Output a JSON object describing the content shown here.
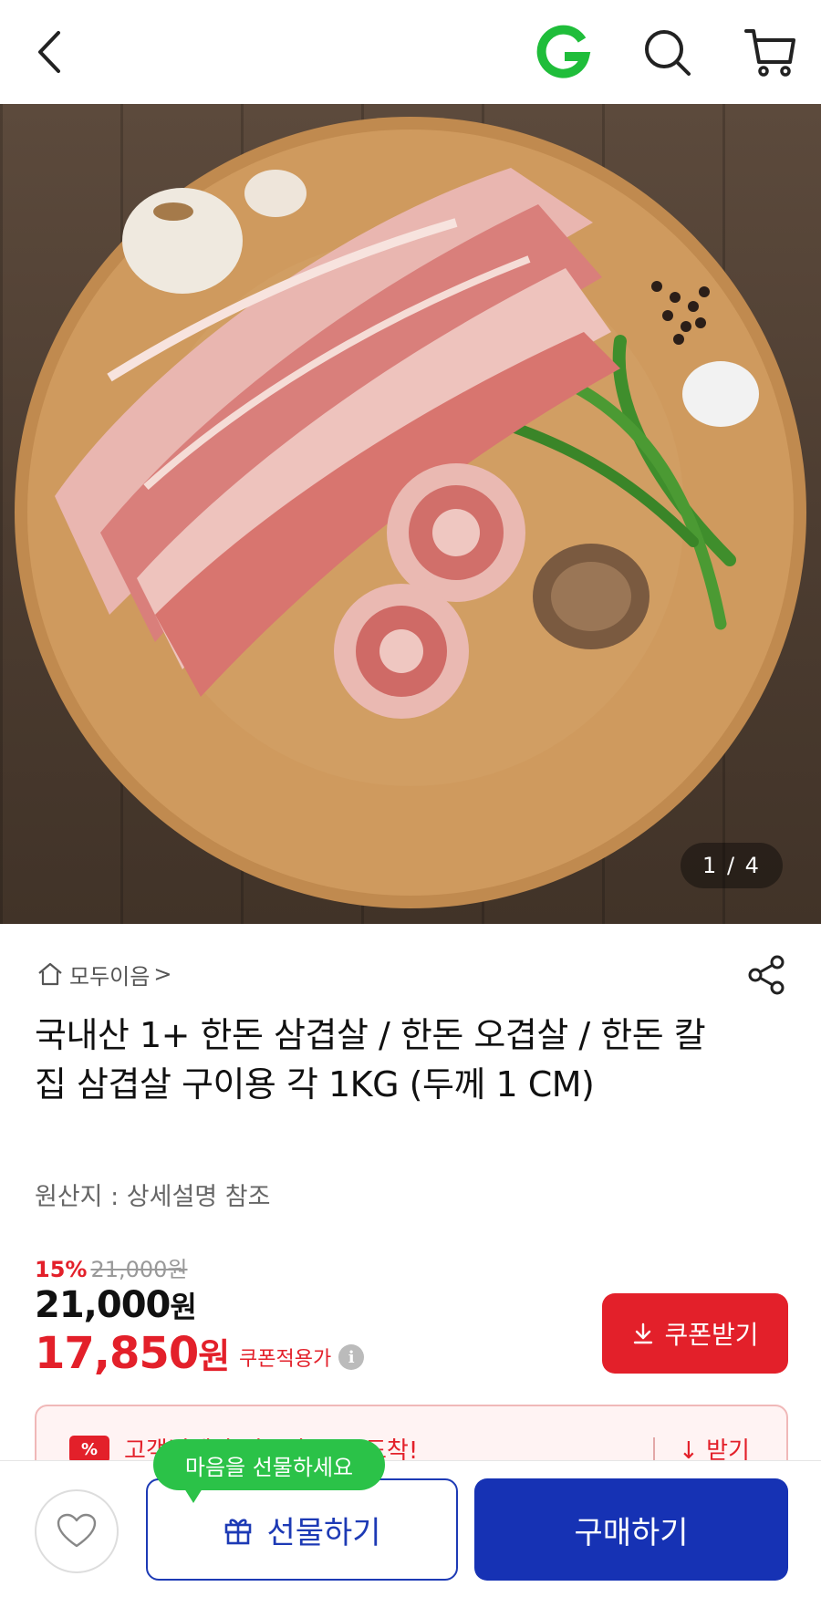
{
  "header": {
    "back_icon": "chevron-left-icon",
    "logo_icon": "g-logo-icon",
    "search_icon": "search-icon",
    "cart_icon": "cart-icon",
    "logo_color": "#1fbd3a"
  },
  "gallery": {
    "counter": "1 / 4"
  },
  "store": {
    "name": "모두이음",
    "chevron": ">",
    "share_icon": "share-icon"
  },
  "product": {
    "title": "국내산 1+ 한돈 삼겹살 / 한돈 오겹살 / 한돈 칼집 삼겹살 구이용 각 1KG (두께 1 CM)",
    "origin": "원산지 : 상세설명 참조"
  },
  "price": {
    "discount_rate": "15%",
    "original": "21,000원",
    "sale_amount": "21,000",
    "sale_unit": "원",
    "coupon_amount": "17,850",
    "coupon_unit": "원",
    "coupon_label": "쿠폰적용가",
    "info_glyph": "i"
  },
  "coupon_button": {
    "label": "쿠폰받기",
    "icon": "download-icon"
  },
  "banner": {
    "badge": "%",
    "text": "고객님께만 신규가 쿠폰 도착!",
    "action": "받기"
  },
  "bottom_bar": {
    "wish_icon": "heart-icon",
    "gift_tooltip": "마음을 선물하세요",
    "gift_label": "선물하기",
    "gift_icon": "gift-icon",
    "buy_label": "구매하기"
  },
  "colors": {
    "accent_red": "#e3202a",
    "primary_blue": "#1632b4",
    "tooltip_green": "#2bc248"
  }
}
